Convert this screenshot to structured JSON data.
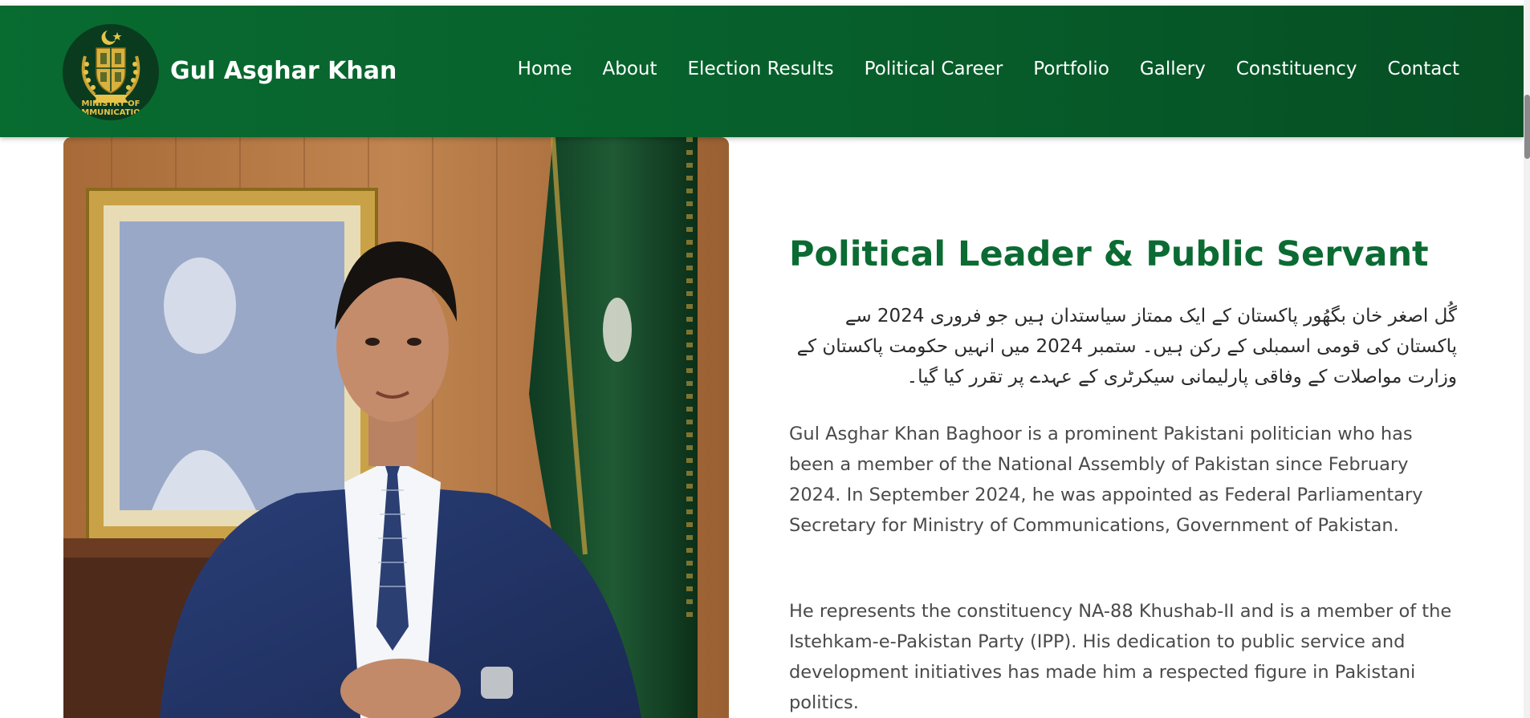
{
  "header": {
    "brand_name": "Gul Asghar Khan",
    "logo": {
      "icon": "state-emblem-icon",
      "line1": "MINISTRY OF",
      "line2": "MMUNICATIO"
    },
    "nav": [
      {
        "label": "Home"
      },
      {
        "label": "About"
      },
      {
        "label": "Election Results"
      },
      {
        "label": "Political Career"
      },
      {
        "label": "Portfolio"
      },
      {
        "label": "Gallery"
      },
      {
        "label": "Constituency"
      },
      {
        "label": "Contact"
      }
    ],
    "bg_color": "#086b30",
    "text_color": "#ffffff"
  },
  "hero": {
    "photo": "portrait-photo",
    "title": "Political Leader & Public Servant",
    "title_color": "#0b6b33",
    "urdu_intro": "گُل اصغر خان بگھُور پاکستان کے ایک ممتاز سیاستدان ہیں جو فروری 2024 سے پاکستان کی قومی اسمبلی کے رکن ہیں۔ ستمبر 2024 میں انہیں حکومت پاکستان کے وزارت مواصلات کے وفاقی پارلیمانی سیکرٹری کے عہدے پر تقرر کیا گیا۔",
    "paragraph1": "Gul Asghar Khan Baghoor is a prominent Pakistani politician who has been a member of the National Assembly of Pakistan since February 2024. In September 2024, he was appointed as Federal Parliamentary Secretary for Ministry of Communications, Government of Pakistan.",
    "paragraph2": "He represents the constituency NA-88 Khushab-II and is a member of the Istehkam-e-Pakistan Party (IPP). His dedication to public service and development initiatives has made him a respected figure in Pakistani politics."
  }
}
